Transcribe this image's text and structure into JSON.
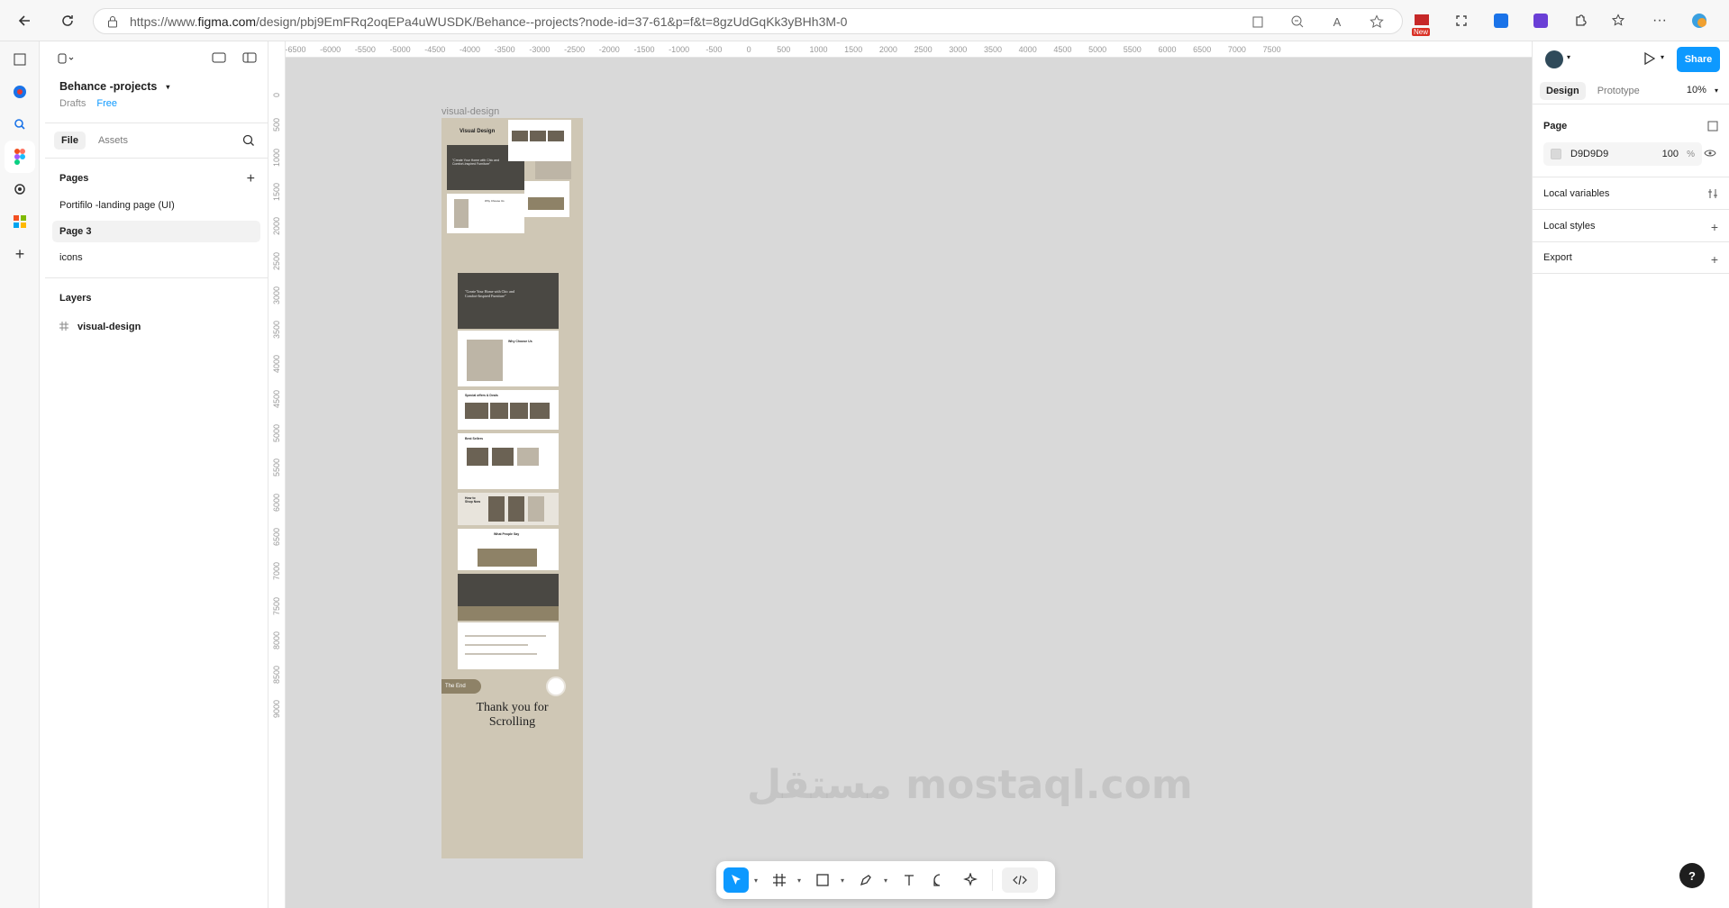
{
  "browser": {
    "url_prefix": "https://www.",
    "url_domain": "figma.com",
    "url_path": "/design/pbj9EmFRq2oqEPa4uWUSDK/Behance--projects?node-id=37-61&p=f&t=8gzUdGqKk3yBHh3M-0",
    "new_badge": "New"
  },
  "project": {
    "name": "Behance -projects",
    "location": "Drafts",
    "plan": "Free"
  },
  "left_tabs": {
    "file": "File",
    "assets": "Assets"
  },
  "pages": {
    "title": "Pages",
    "items": [
      "Portifilo -landing page (UI)",
      "Page 3",
      "icons"
    ],
    "active_index": 1
  },
  "layers": {
    "title": "Layers",
    "items": [
      "visual-design"
    ]
  },
  "canvas": {
    "frame_label": "visual-design",
    "ruler_top": [
      "-6500",
      "-6000",
      "-5500",
      "-5000",
      "-4500",
      "-4000",
      "-3500",
      "-3000",
      "-2500",
      "-2000",
      "-1500",
      "-1000",
      "-500",
      "0",
      "500",
      "1000",
      "1500",
      "2000",
      "2500",
      "3000",
      "3500",
      "4000",
      "4500",
      "5000",
      "5500",
      "6000",
      "6500",
      "7000",
      "7500"
    ],
    "ruler_left": [
      "0",
      "500",
      "1000",
      "1500",
      "2000",
      "2500",
      "3000",
      "3500",
      "4000",
      "4500",
      "5000",
      "5500",
      "6000",
      "6500",
      "7000",
      "7500",
      "8000",
      "8500",
      "9000"
    ],
    "mock_title": "Visual Design",
    "hero_text": "\"Create Your Home with Chic and Comfort-Inspired Furniture\"",
    "section_why": "Why Choose Us",
    "section_offers": "Special offers & Deals",
    "section_best": "Best Sellers",
    "section_how": "How to Shop Now",
    "section_people": "What People Say",
    "end_label": "The End",
    "thanks_line1": "Thank you for",
    "thanks_line2": "Scrolling",
    "watermark": "مستقل mostaql.com"
  },
  "right_panel": {
    "share": "Share",
    "tab_design": "Design",
    "tab_prototype": "Prototype",
    "zoom": "10%",
    "page_section": "Page",
    "fill_hex": "D9D9D9",
    "fill_opacity": "100",
    "fill_percent": "%",
    "local_variables": "Local variables",
    "local_styles": "Local styles",
    "export": "Export",
    "help": "?"
  },
  "colors": {
    "accent": "#0d99ff",
    "canvas_bg": "#d9d9d9",
    "frame_bg": "#cfc7b5",
    "olive": "#8e8267"
  }
}
